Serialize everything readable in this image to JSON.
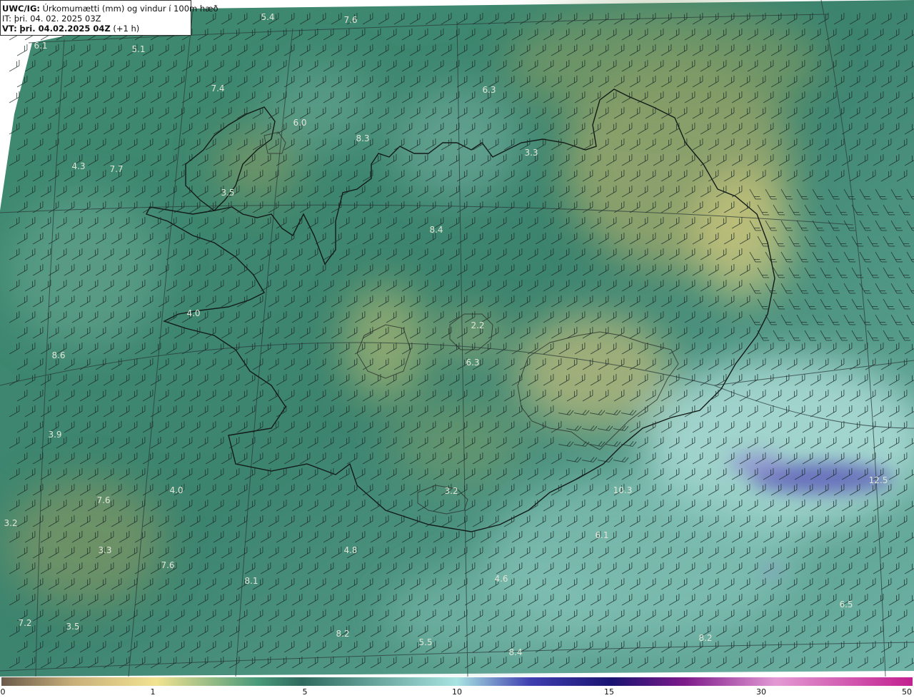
{
  "header": {
    "model": "UWC/IG:",
    "description": "Úrkomumætti (mm) og vindur í 100m hæð",
    "it_prefix": "IT:",
    "it_value": "þri. 04. 02. 2025 03Z",
    "vt_prefix": "VT:",
    "vt_value": "þri. 04.02.2025 04Z",
    "vt_offset": "(+1 h)"
  },
  "map_values": [
    {
      "text": "5.4"
    },
    {
      "text": "7.6"
    },
    {
      "text": "6.1"
    },
    {
      "text": "5.1"
    },
    {
      "text": "7.4"
    },
    {
      "text": "6.3"
    },
    {
      "text": "6.0"
    },
    {
      "text": "8.3"
    },
    {
      "text": "3.3"
    },
    {
      "text": "4.3"
    },
    {
      "text": "7.7"
    },
    {
      "text": "3.5"
    },
    {
      "text": "8.4"
    },
    {
      "text": "4.0"
    },
    {
      "text": "2.2"
    },
    {
      "text": "6.3"
    },
    {
      "text": "8.6"
    },
    {
      "text": "3.9"
    },
    {
      "text": "4.0"
    },
    {
      "text": "7.6"
    },
    {
      "text": "3.2"
    },
    {
      "text": "3.2"
    },
    {
      "text": "10.3"
    },
    {
      "text": "12.5"
    },
    {
      "text": "6.1"
    },
    {
      "text": "3.3"
    },
    {
      "text": "4.8"
    },
    {
      "text": "7.6"
    },
    {
      "text": "8.1"
    },
    {
      "text": "4.6"
    },
    {
      "text": "6.5"
    },
    {
      "text": "7.2"
    },
    {
      "text": "3.5"
    },
    {
      "text": "8.2"
    },
    {
      "text": "5.5"
    },
    {
      "text": "8.4"
    },
    {
      "text": "8.2"
    }
  ],
  "colorbar": {
    "ticks": [
      "0",
      "1",
      "5",
      "10",
      "15",
      "30",
      "50"
    ],
    "colors": [
      "#6b5a4a",
      "#c9b07a",
      "#f2e391",
      "#4a9a7a",
      "#2f6a5e",
      "#a9e4e2",
      "#3f3fb0",
      "#1a1370",
      "#7d1a8a",
      "#e39ad4",
      "#c2208f"
    ]
  }
}
